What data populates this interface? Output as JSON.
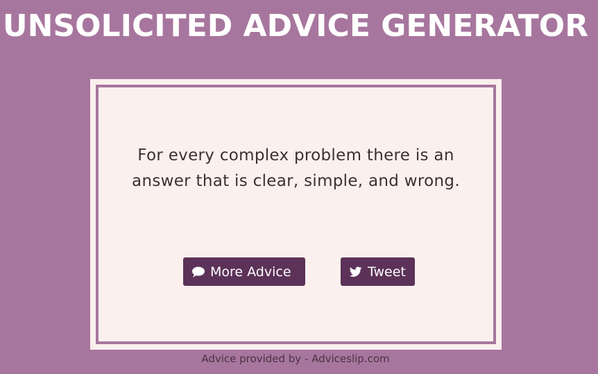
{
  "header": {
    "title": "UNSOLICITED ADVICE GENERATOR"
  },
  "card": {
    "quote": "For every complex problem there is an answer that is clear, simple, and wrong."
  },
  "buttons": {
    "more_advice_label": "More Advice",
    "more_advice_icon": "comment-icon",
    "tweet_label": "Tweet",
    "tweet_icon": "twitter-icon"
  },
  "footer": {
    "credit": "Advice provided by - Adviceslip.com"
  },
  "colors": {
    "background": "#a7769e",
    "card": "#fbf0ee",
    "button": "#5c3258",
    "text": "#3c3034"
  }
}
